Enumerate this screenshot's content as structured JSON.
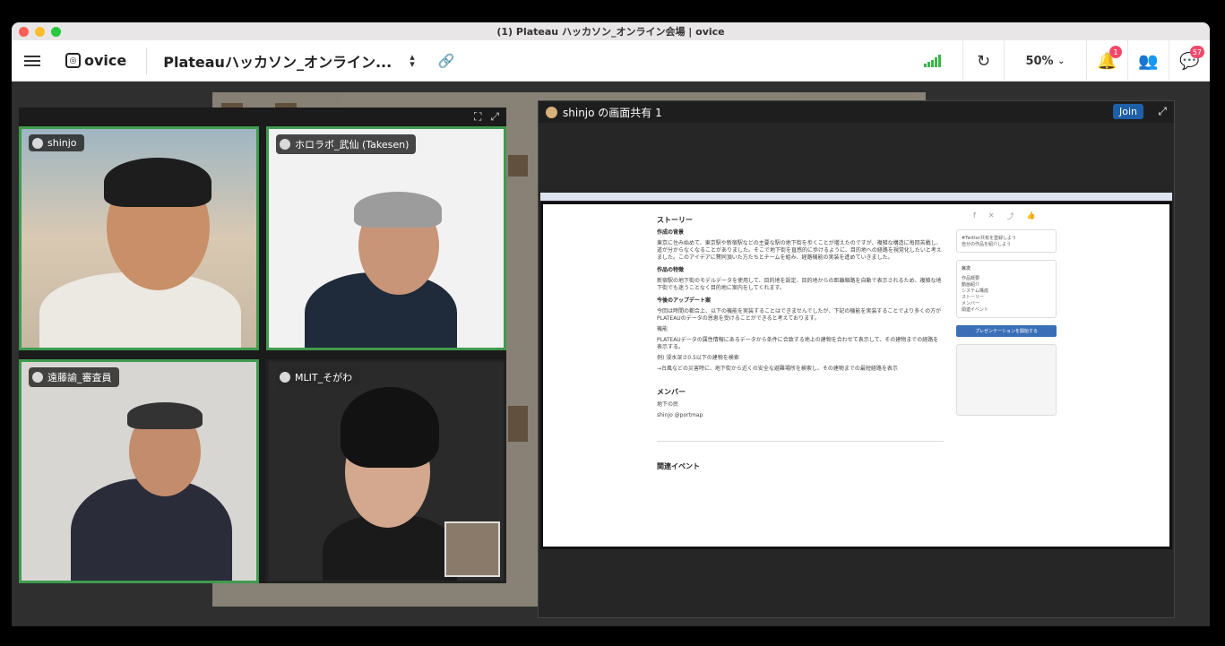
{
  "window": {
    "title": "(1) Plateau ハッカソン_オンライン会場 | ovice"
  },
  "topbar": {
    "logo_text": "ovice",
    "space_name": "Plateauハッカソン_オンライン...",
    "zoom_label": "50%",
    "notifications_count": "1",
    "messages_count": "57"
  },
  "video_tiles": [
    {
      "name": "shinjo"
    },
    {
      "name": "ホロラボ_武仙 (Takesen)"
    },
    {
      "name": "遠藤諭_審査員"
    },
    {
      "name": "MLIT_そがわ"
    }
  ],
  "screen_share": {
    "title": "shinjo の画面共有 1",
    "join_label": "Join",
    "doc": {
      "heading": "ストーリー",
      "section1_title": "作成の背景",
      "section1_body": "東京に住み始めて、東京駅や新宿駅などの主要な駅の地下街を歩くことが増えたのですが、複雑な構造に毎回苦戦し、道が分からなくなることがありました。そこで地下街を直感的に歩けるように、目的地への経路を視覚化したいと考えました。このアイデアに賛同頂いた方たちとチームを組み、経路機能の実装を進めていきました。",
      "section2_title": "作品の特徴",
      "section2_body": "新宿駅の地下街のモデルデータを使用して、目的地を設定、目的地からの距離順路を自動で表示されるため、複雑な地下街でも迷うことなく目的地に案内をしてくれます。",
      "section3_title": "今後のアップデート案",
      "section3_body": "今回は時間の都合上、以下の機能を実装することはできませんでしたが、下記の機能を実装することでより多くの方がPLATEAUのデータの恩恵を受けることができると考えております。",
      "feature_label": "機能",
      "feature_body": "PLATEAUデータの属性情報にあるデータから条件に合致する地上の建物を合わせて表示して、その建物までの経路を表示する。",
      "example_label": "例) 浸水深さ0.5以下の建物を検索",
      "example_body": "→台風などの災害時に、地下街から近くの安全な避難場所を検索し、その建物までの最短経路を表示",
      "members_title": "メンバー",
      "team_name": "地下の民",
      "member_name": "shinjo @portmap",
      "related_title": "関連イベント",
      "twitter_card_title": "#Twitter共有を登録しよう",
      "twitter_card_body": "自分の作品を紹介しよう",
      "toc_title": "目次",
      "toc_items": [
        "作品概要",
        "動画紹介",
        "システム構成",
        "ストーリー",
        "メンバー",
        "関連イベント"
      ],
      "present_button": "プレゼンテーションを開始する"
    }
  },
  "colors": {
    "active_border": "#3f9b4f",
    "join_button": "#1f5fa8",
    "badge": "#f04a6b",
    "signal": "#3cb44a"
  }
}
